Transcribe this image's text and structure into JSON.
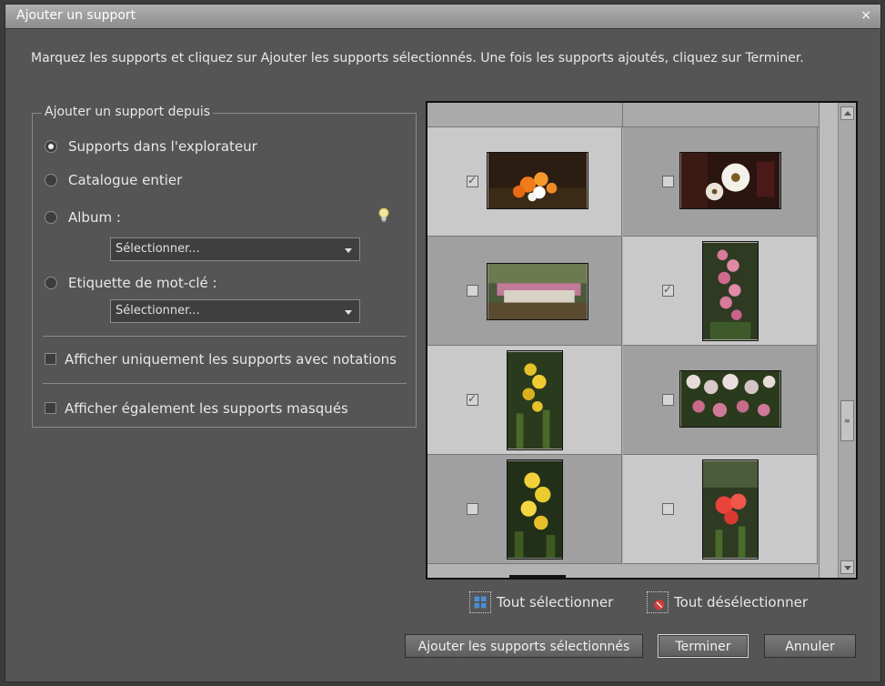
{
  "window": {
    "title": "Ajouter un support",
    "close_glyph": "×",
    "instruction": "Marquez les supports et cliquez sur Ajouter les supports sélectionnés. Une fois les supports ajoutés, cliquez sur Terminer."
  },
  "source_group": {
    "legend": "Ajouter un support depuis",
    "options": [
      {
        "label": "Supports dans l'explorateur",
        "selected": true
      },
      {
        "label": "Catalogue entier",
        "selected": false
      },
      {
        "label": "Album :",
        "selected": false
      },
      {
        "label": "Etiquette de mot-clé :",
        "selected": false
      }
    ],
    "album_select": "Sélectionner...",
    "keyword_select": "Sélectionner...",
    "checkboxes": [
      {
        "label": "Afficher uniquement les supports avec notations",
        "checked": false
      },
      {
        "label": "Afficher également les supports masqués",
        "checked": false
      }
    ],
    "tip_icon": "lightbulb-icon"
  },
  "media_grid": {
    "columns": 2,
    "items": [
      {
        "checked": true,
        "thumb": "orange-gerbera-flowers",
        "orientation": "landscape"
      },
      {
        "checked": false,
        "thumb": "white-gerbera-flowers",
        "orientation": "landscape"
      },
      {
        "checked": false,
        "thumb": "pink-flower-garden",
        "orientation": "landscape"
      },
      {
        "checked": true,
        "thumb": "pink-orchid-spike",
        "orientation": "portrait"
      },
      {
        "checked": true,
        "thumb": "yellow-orchid",
        "orientation": "portrait"
      },
      {
        "checked": false,
        "thumb": "pink-orchids-cluster",
        "orientation": "landscape"
      },
      {
        "checked": false,
        "thumb": "yellow-orchid-bloom",
        "orientation": "portrait"
      },
      {
        "checked": false,
        "thumb": "red-orchid",
        "orientation": "portrait"
      }
    ],
    "scrollbar": {
      "position": 0.55
    }
  },
  "selection_links": {
    "select_all": {
      "label": "Tout sélectionner",
      "icon": "select-all-icon"
    },
    "deselect_all": {
      "label": "Tout désélectionner",
      "icon": "deselect-all-icon"
    }
  },
  "buttons": {
    "add_selected": "Ajouter les supports sélectionnés",
    "done": "Terminer",
    "cancel": "Annuler"
  },
  "colors": {
    "dialog_bg": "#555555",
    "text": "#e8e8e8",
    "grid_light": "#c9c9c9",
    "grid_dark": "#a0a0a0"
  }
}
